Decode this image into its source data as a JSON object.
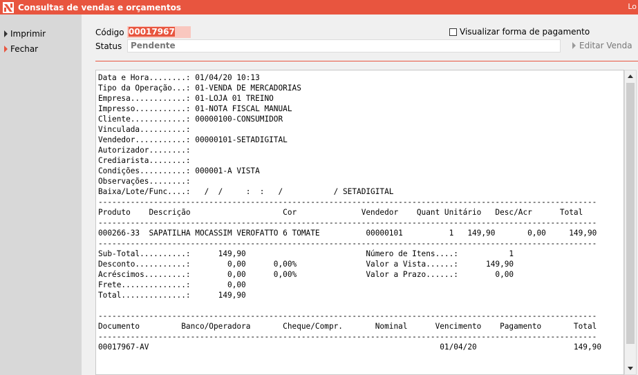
{
  "window": {
    "title": "Consultas de vendas e orçamentos",
    "right_fragment": "Lo",
    "accent_color": "#e8553f"
  },
  "sidebar": {
    "items": [
      {
        "label": "Imprimir",
        "icon": "triangle-right-icon"
      },
      {
        "label": "Fechar",
        "icon": "triangle-right-orange-icon"
      }
    ]
  },
  "form": {
    "codigo_label": "Código",
    "codigo_value": "00017967",
    "status_label": "Status",
    "status_value": "Pendente",
    "visualizar_label": "Visualizar forma de pagamento",
    "visualizar_checked": false,
    "editar_label": "Editar Venda"
  },
  "report": {
    "lines": [
      "Data e Hora........: 01/04/20 10:13",
      "Tipo da Operação...: 01-VENDA DE MERCADORIAS",
      "Empresa............: 01-LOJA 01 TREINO",
      "Impresso...........: 01-NOTA FISCAL MANUAL",
      "Cliente............: 00000100-CONSUMIDOR",
      "Vinculada..........:",
      "Vendedor...........: 00000101-SETADIGITAL",
      "Autorizador........:",
      "Crediarista........:",
      "Condições..........: 000001-A VISTA",
      "Observações........:",
      "Baixa/Lote/Func....:   /  /     :  :   /           / SETADIGITAL",
      "------------------------------------------------------------------------------------------------------------",
      "Produto    Descrição                    Cor              Vendedor    Quant Unitário   Desc/Acr      Total",
      "------------------------------------------------------------------------------------------------------------",
      "000266-33  SAPATILHA MOCASSIM VEROFATTO 6 TOMATE          00000101          1   149,90       0,00     149,90",
      "------------------------------------------------------------------------------------------------------------",
      "Sub-Total..........:      149,90                          Número de Itens....:           1",
      "Desconto...........:        0,00      0,00%               Valor a Vista......:      149,90",
      "Acréscimos.........:        0,00      0,00%               Valor a Prazo......:        0,00",
      "Frete..............:        0,00",
      "Total..............:      149,90",
      "",
      "------------------------------------------------------------------------------------------------------------",
      "Documento         Banco/Operadora       Cheque/Compr.       Nominal      Vencimento    Pagamento       Total",
      "------------------------------------------------------------------------------------------------------------",
      "00017967-AV                                                               01/04/20                     149,90"
    ]
  }
}
